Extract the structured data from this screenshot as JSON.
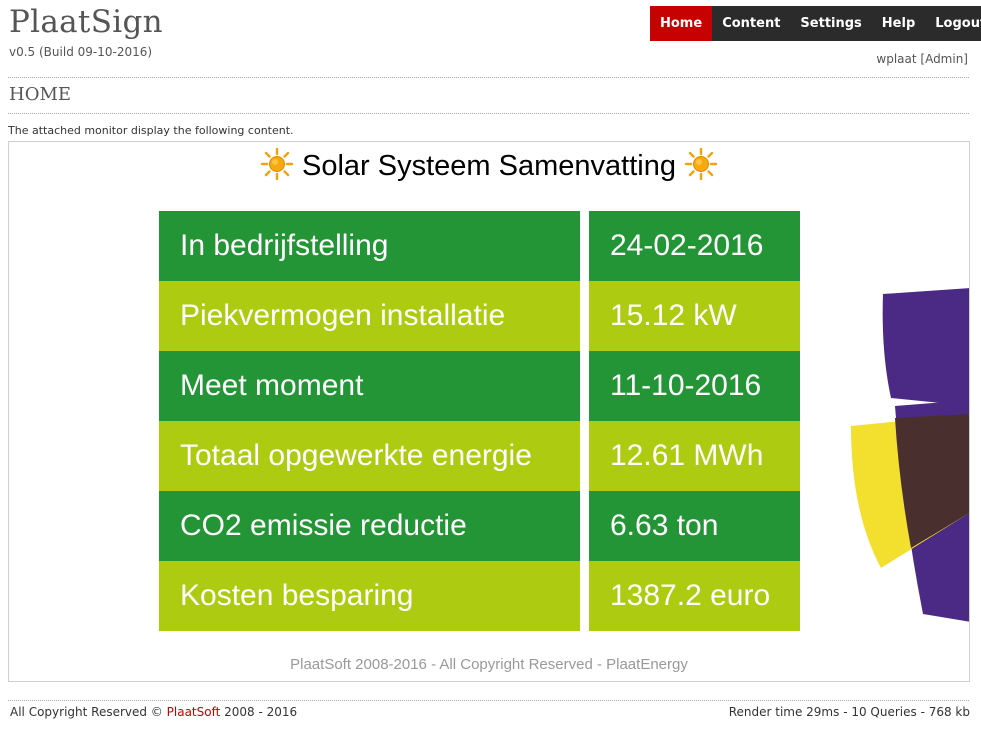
{
  "header": {
    "app_title": "PlaatSign",
    "version": "v0.5 (Build 09-10-2016)",
    "user": "wplaat [Admin]"
  },
  "nav": {
    "items": [
      {
        "label": "Home",
        "active": true
      },
      {
        "label": "Content",
        "active": false
      },
      {
        "label": "Settings",
        "active": false
      },
      {
        "label": "Help",
        "active": false
      },
      {
        "label": "Logout",
        "active": false
      }
    ]
  },
  "page": {
    "heading": "HOME",
    "intro": "The attached monitor display the following content."
  },
  "display": {
    "title": "Solar Systeem Samenvatting",
    "title_icon": "sun-icon",
    "rows": [
      {
        "label": "In bedrijfstelling",
        "value": "24-02-2016"
      },
      {
        "label": "Piekvermogen installatie",
        "value": "15.12 kW"
      },
      {
        "label": "Meet moment",
        "value": "11-10-2016"
      },
      {
        "label": "Totaal opgewerkte energie",
        "value": "12.61 MWh"
      },
      {
        "label": "CO2 emissie reductie",
        "value": "6.63 ton"
      },
      {
        "label": "Kosten besparing",
        "value": "1387.2 euro"
      }
    ],
    "footer": "PlaatSoft 2008-2016 - All Copyright Reserved - PlaatEnergy"
  },
  "footer": {
    "copyright_prefix": "All Copyright Reserved ©",
    "brand": "PlaatSoft",
    "copyright_years": "2008 - 2016",
    "stats": "Render time 29ms - 10 Queries - 768 kb"
  },
  "colors": {
    "nav_bg": "#2b2b2b",
    "nav_active": "#c70000",
    "row_dark_green": "#239536",
    "row_light_green": "#adcb11",
    "brand_red": "#c70000",
    "logo_purple": "#4a2a84",
    "logo_yellow": "#f3df2e",
    "logo_brown": "#4a2f2f"
  }
}
